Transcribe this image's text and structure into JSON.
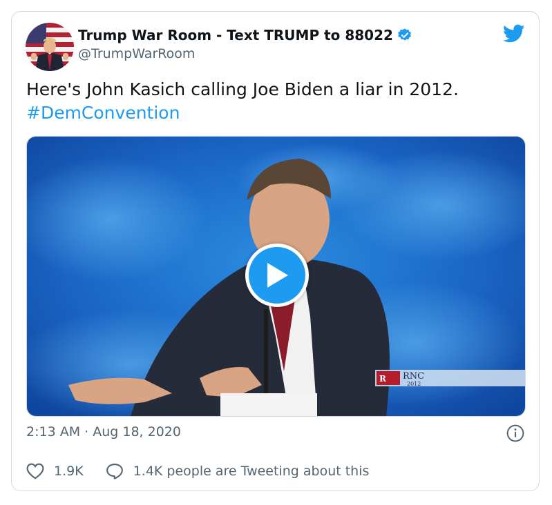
{
  "author": {
    "name": "Trump War Room - Text TRUMP to 88022",
    "handle": "@TrumpWarRoom",
    "verified": true
  },
  "tweet": {
    "text": "Here's John Kasich calling Joe Biden a liar in 2012.",
    "hashtag": "#DemConvention"
  },
  "media": {
    "type": "video",
    "overlay_logo_text": "RNC 2012"
  },
  "timestamp": "2:13 AM · Aug 18, 2020",
  "actions": {
    "likes": "1.9K",
    "conversation": "1.4K people are Tweeting about this"
  },
  "colors": {
    "accent": "#1d9bf0",
    "text": "#0f1419",
    "secondary": "#536471",
    "border": "#cfd9de"
  },
  "icons": [
    "twitter-bird-icon",
    "verified-badge-icon",
    "play-icon",
    "info-icon",
    "heart-icon",
    "reply-bubble-icon"
  ]
}
